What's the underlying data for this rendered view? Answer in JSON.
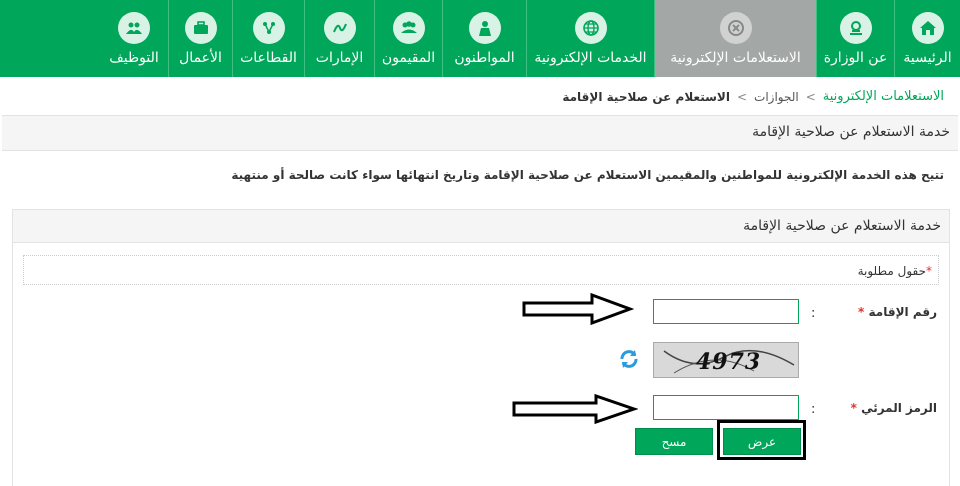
{
  "nav": {
    "items": [
      {
        "label": "الرئيسية",
        "icon": "home-icon",
        "active": false
      },
      {
        "label": "عن الوزارة",
        "icon": "ministry-emblem-icon",
        "active": false
      },
      {
        "label": "الاستعلامات الإلكترونية",
        "icon": "inquiry-icon",
        "active": true
      },
      {
        "label": "الخدمات الإلكترونية",
        "icon": "globe-icon",
        "active": false
      },
      {
        "label": "المواطنون",
        "icon": "citizen-icon",
        "active": false
      },
      {
        "label": "المقيمون",
        "icon": "residents-icon",
        "active": false
      },
      {
        "label": "الإمارات",
        "icon": "regions-icon",
        "active": false
      },
      {
        "label": "القطاعات",
        "icon": "network-icon",
        "active": false
      },
      {
        "label": "الأعمال",
        "icon": "briefcase-icon",
        "active": false
      },
      {
        "label": "التوظيف",
        "icon": "team-icon",
        "active": false
      }
    ],
    "colors": {
      "bg": "#00a65a",
      "active_bg": "#a3a8a6"
    }
  },
  "breadcrumb": {
    "root": "الاستعلامات الإلكترونية",
    "middle": "الجوازات",
    "current": "الاستعلام عن صلاحية الإقامة",
    "separator": ">"
  },
  "page": {
    "title": "خدمة الاستعلام عن صلاحية الإقامة",
    "description": "تتيح هذه الخدمة الإلكترونية للمواطنين والمقيمين الاستعلام عن صلاحية الإقامة وتاريخ انتهائها سواء كانت صالحة أو منتهية"
  },
  "form": {
    "panel_title": "خدمة الاستعلام عن صلاحية الإقامة",
    "required_star": "*",
    "required_note": "حقول مطلوبة",
    "iqama_label": "رقم الإقامة",
    "captcha_label": "الرمز المرئي",
    "colon": ":",
    "iqama_value": "",
    "captcha_value": "",
    "captcha_code": "4973",
    "submit_label": "عرض",
    "clear_label": "مسح"
  }
}
